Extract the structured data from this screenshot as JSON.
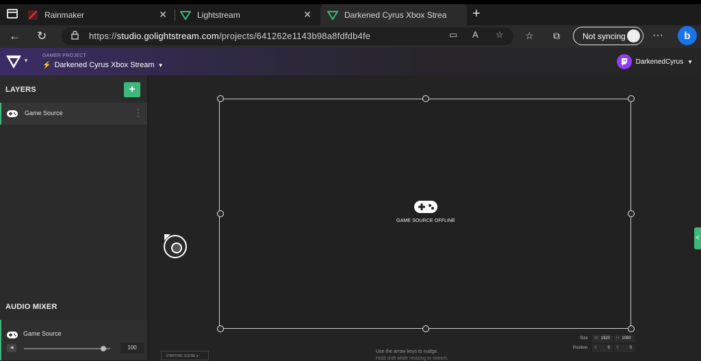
{
  "browser": {
    "tabs": [
      {
        "title": "Rainmaker",
        "close": "✕"
      },
      {
        "title": "Lightstream",
        "close": "✕"
      },
      {
        "title": "Darkened Cyrus Xbox Stream - L",
        "close": "✕"
      }
    ],
    "new_tab": "+",
    "url_prefix": "https://",
    "url_host": "studio.golightstream.com",
    "url_path": "/projects/641262e1143b98a8fdfdb4fe",
    "sync_label": "Not syncing",
    "bing_label": "b"
  },
  "app": {
    "project_kind": "GAMER PROJECT",
    "project_name": "Darkened Cyrus Xbox Stream",
    "username": "DarkenedCyrus",
    "accent": "#3cb97a",
    "twitch_color": "#8f3ff0"
  },
  "sidebar": {
    "layers_title": "LAYERS",
    "add_label": "+",
    "layer_name": "Game Source",
    "mixer_title": "AUDIO MIXER",
    "mixer_source": "Game Source",
    "mute_icon": "◀",
    "volume": "100",
    "volume_level": 0.95
  },
  "stage": {
    "offline_label": "GAME SOURCE OFFLINE",
    "size_label": "Size",
    "position_label": "Position",
    "width_key": "W",
    "height_key": "H",
    "x_key": "X",
    "y_key": "Y",
    "width": "1920",
    "height": "1080",
    "pos_x": "0",
    "pos_y": "0",
    "scene_chip": "STARTING SCENE",
    "hint_1": "Use the arrow keys to nudge.",
    "hint_2": "Hold shift while resizing to stretch.",
    "edge_tab_icon": "<"
  }
}
